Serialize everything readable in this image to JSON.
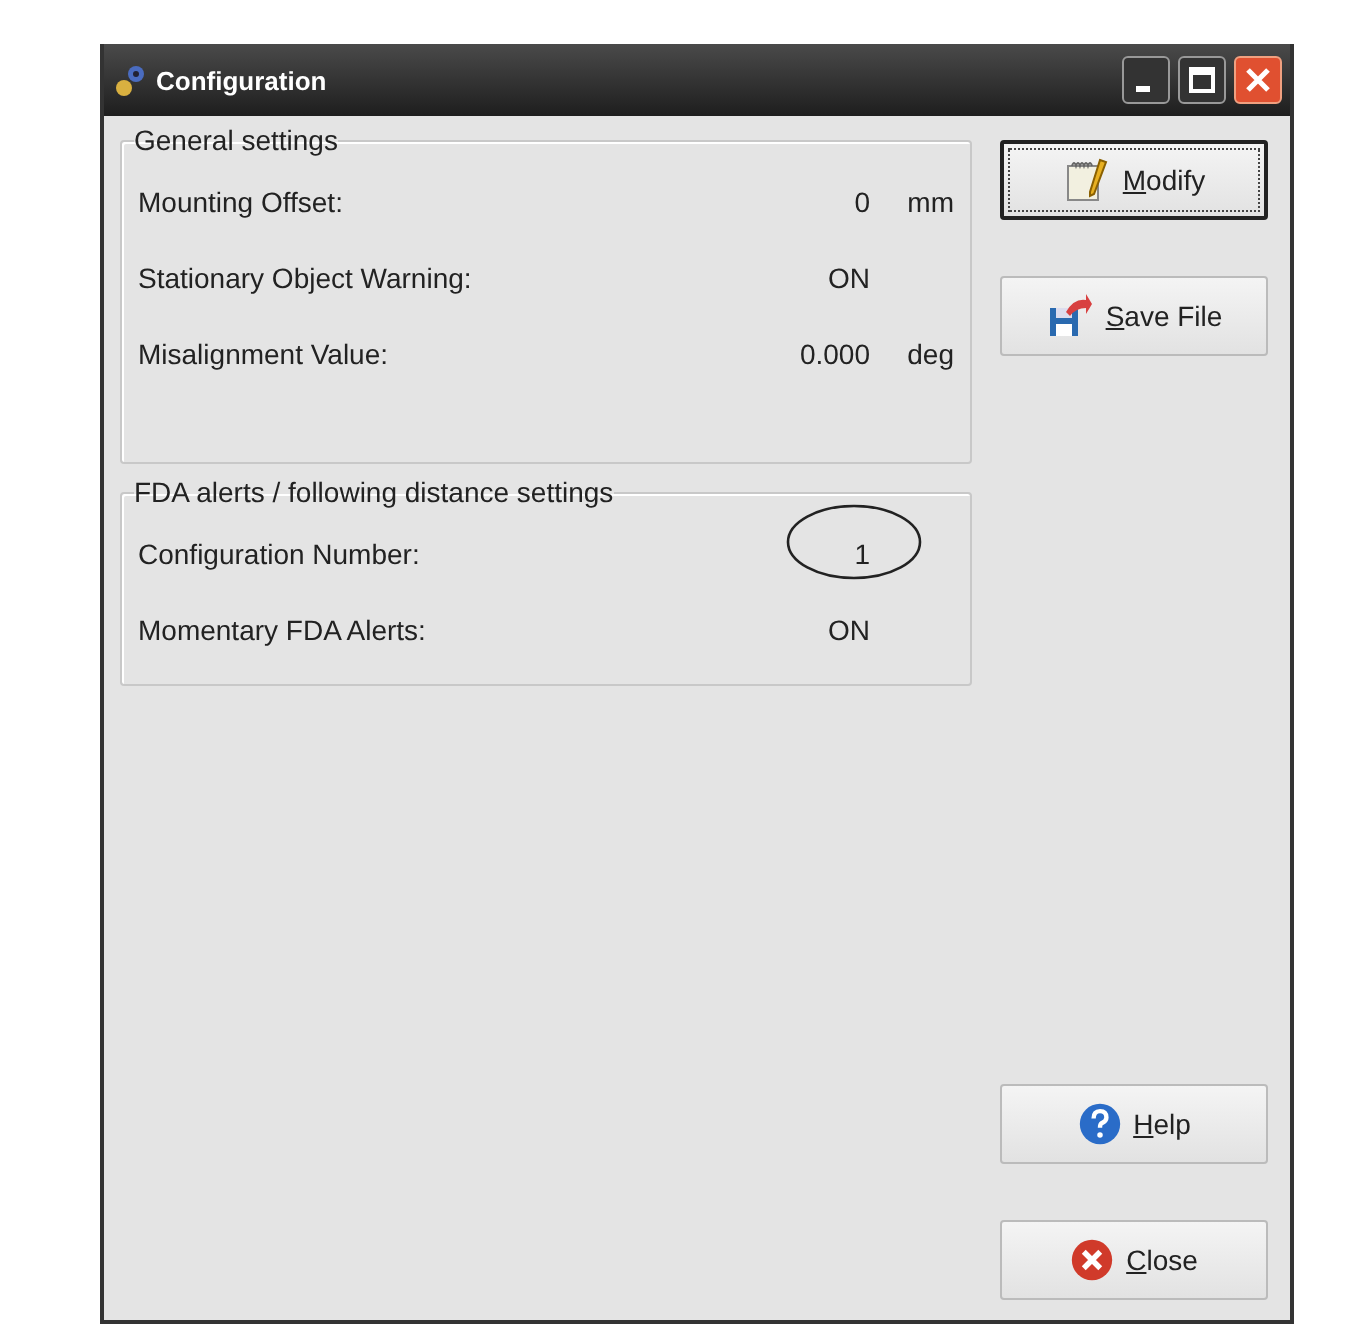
{
  "window": {
    "title": "Configuration"
  },
  "groups": [
    {
      "title": "General settings",
      "rows": [
        {
          "label": "Mounting Offset:",
          "value": "0",
          "unit": "mm",
          "circled": false
        },
        {
          "label": "Stationary Object Warning:",
          "value": "ON",
          "circled": false
        },
        {
          "label": "Misalignment Value:",
          "value": "0.000",
          "unit": "deg",
          "circled": false
        }
      ]
    },
    {
      "title": "FDA alerts / following distance settings",
      "rows": [
        {
          "label": "Configuration Number:",
          "value": "1",
          "circled": true
        },
        {
          "label": "Momentary FDA Alerts:",
          "value": "ON",
          "circled": false
        }
      ]
    }
  ],
  "buttons": [
    {
      "label": "Modify",
      "kind": "modify",
      "focused": true
    },
    {
      "label": "Save File",
      "kind": "save",
      "focused": false
    },
    {
      "label": "Help",
      "kind": "help",
      "focused": false
    },
    {
      "label": "Close",
      "kind": "close",
      "focused": false
    }
  ]
}
